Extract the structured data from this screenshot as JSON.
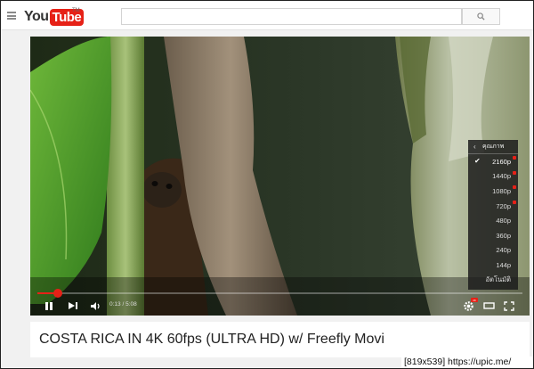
{
  "header": {
    "logo_you": "You",
    "logo_tube": "Tube",
    "logo_tm": "TM",
    "search_placeholder": ""
  },
  "player": {
    "current_time": "0:13 / 5:08",
    "progress_fraction": 0.043,
    "quality_menu": {
      "title": "คุณภาพ",
      "items": [
        {
          "label": "2160p",
          "selected": true,
          "hd": true
        },
        {
          "label": "1440p",
          "selected": false,
          "hd": true
        },
        {
          "label": "1080p",
          "selected": false,
          "hd": true
        },
        {
          "label": "720p",
          "selected": false,
          "hd": true
        },
        {
          "label": "480p",
          "selected": false,
          "hd": false
        },
        {
          "label": "360p",
          "selected": false,
          "hd": false
        },
        {
          "label": "240p",
          "selected": false,
          "hd": false
        },
        {
          "label": "144p",
          "selected": false,
          "hd": false
        },
        {
          "label": "อัตโนมัติ",
          "selected": false,
          "hd": false
        }
      ]
    },
    "hd_badge": "4K"
  },
  "video": {
    "title": "COSTA RICA IN 4K 60fps (ULTRA HD) w/ Freefly Movi"
  },
  "watermark": "[819x539] https://upic.me/",
  "colors": {
    "brand_red": "#e62117",
    "menu_bg": "#1c1c1c"
  }
}
